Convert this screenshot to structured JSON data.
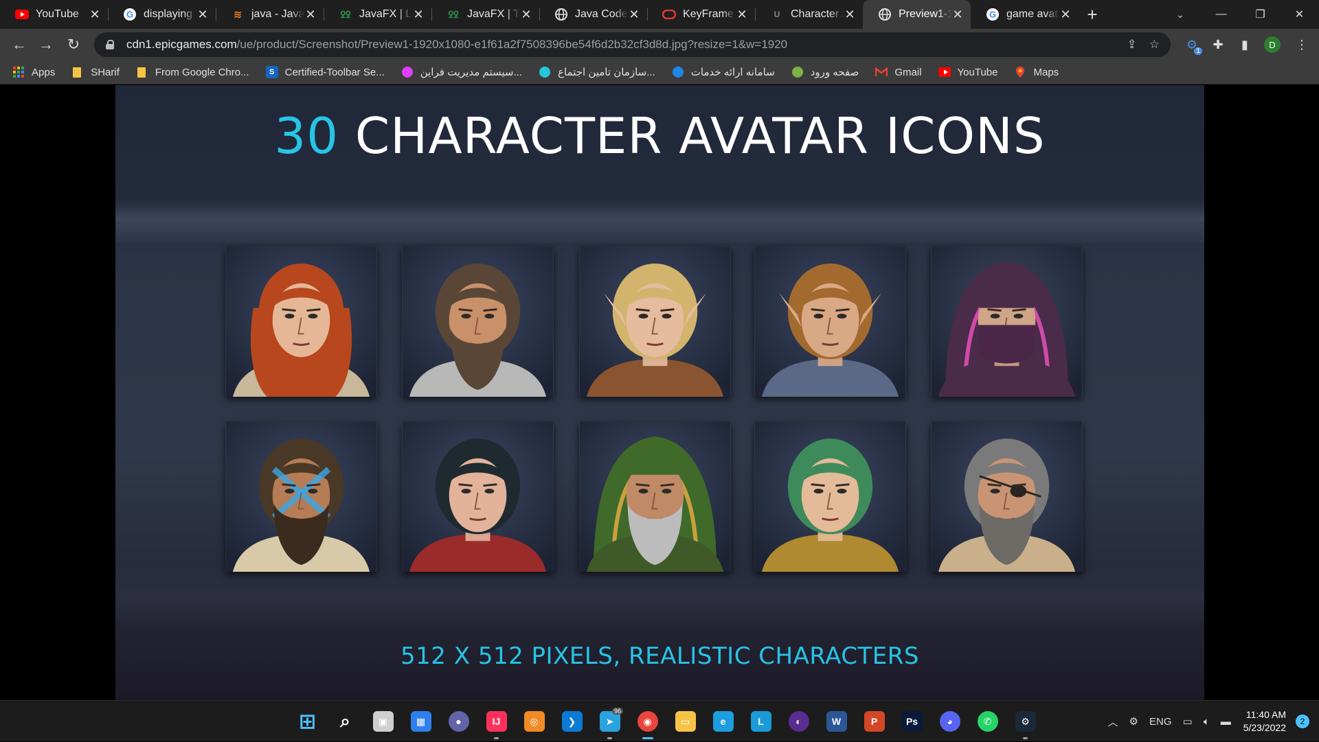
{
  "browser": {
    "tabs": [
      {
        "title": "YouTube",
        "favicon": "youtube-icon",
        "color": "#ff0000",
        "active": false
      },
      {
        "title": "displaying t",
        "favicon": "google-icon",
        "color": "#4285f4",
        "active": false
      },
      {
        "title": "java - JavaF",
        "favicon": "stackoverflow-icon",
        "color": "#f48024",
        "active": false
      },
      {
        "title": "JavaFX | Lab",
        "favicon": "geeksforgeeks-icon",
        "color": "#2f8d46",
        "active": false
      },
      {
        "title": "JavaFX | Tex",
        "favicon": "geeksforgeeks-icon",
        "color": "#2f8d46",
        "active": false
      },
      {
        "title": "Java Code E",
        "favicon": "globe-icon",
        "color": "#e0e0e0",
        "active": false
      },
      {
        "title": "KeyFrame (",
        "favicon": "oracle-icon",
        "color": "#e53935",
        "active": false
      },
      {
        "title": "Character A",
        "favicon": "unreal-icon",
        "color": "#444444",
        "active": false
      },
      {
        "title": "Preview1-1",
        "favicon": "globe-icon",
        "color": "#e0e0e0",
        "active": true
      },
      {
        "title": "game avata",
        "favicon": "google-icon",
        "color": "#4285f4",
        "active": false
      }
    ],
    "new_tab": "+",
    "url_host": "cdn1.epicgames.com",
    "url_path": "/ue/product/Screenshot/Preview1-1920x1080-e1f61a2f7508396be54f6d2b32cf3d8d.jpg?resize=1&w=1920",
    "profile_initial": "D",
    "extension_badge": "1",
    "bookmarks": [
      {
        "label": "Apps",
        "icon": "apps-grid-icon",
        "color": "#4285f4"
      },
      {
        "label": "SHarif",
        "icon": "folder-icon",
        "color": "#f6c445"
      },
      {
        "label": "From Google Chro...",
        "icon": "folder-icon",
        "color": "#f6c445"
      },
      {
        "label": "Certified-Toolbar Se...",
        "icon": "certified-icon",
        "color": "#1565c0"
      },
      {
        "label": "سیستم مدیریت فراین...",
        "icon": "flower-icon",
        "color": "#e040fb"
      },
      {
        "label": "سازمان تامین اجتماع...",
        "icon": "cloud-icon",
        "color": "#26c6da"
      },
      {
        "label": "سامانه ارائه خدمات",
        "icon": "emblem-icon",
        "color": "#1e88e5"
      },
      {
        "label": "صفحه ورود",
        "icon": "seal-icon",
        "color": "#7cb342"
      },
      {
        "label": "Gmail",
        "icon": "gmail-icon",
        "color": "#ea4335"
      },
      {
        "label": "YouTube",
        "icon": "youtube-icon",
        "color": "#ff0000"
      },
      {
        "label": "Maps",
        "icon": "maps-pin-icon",
        "color": "#34a853"
      }
    ]
  },
  "page": {
    "headline_number": "30",
    "headline_text": "CHARACTER AVATAR ICONS",
    "subline": "512 X 512 PIXELS, REALISTIC CHARACTERS",
    "accent_color": "#27c4e6",
    "avatars": [
      {
        "name": "red-haired-warrior-woman",
        "bg": "#2a3246",
        "skin": "#e5b797",
        "hair": "#b8471e",
        "garb": "#c9b79a",
        "beard": false,
        "hood": false,
        "mask": false,
        "elf": false
      },
      {
        "name": "bearded-dwarf",
        "bg": "#2a3246",
        "skin": "#c99169",
        "hair": "#5a4637",
        "garb": "#b8b8b8",
        "beard": true,
        "beardColor": "#5a4637",
        "hood": false,
        "mask": false,
        "elf": false
      },
      {
        "name": "blonde-elf-woman",
        "bg": "#2a3246",
        "skin": "#e6bc9e",
        "hair": "#d2b46c",
        "garb": "#8a5430",
        "beard": false,
        "hood": false,
        "mask": false,
        "elf": true
      },
      {
        "name": "elf-knight",
        "bg": "#2a3246",
        "skin": "#d9a885",
        "hair": "#a36a2f",
        "garb": "#5a6a86",
        "beard": false,
        "hood": false,
        "mask": false,
        "elf": true
      },
      {
        "name": "hooded-masked-assassin",
        "bg": "#2a3246",
        "skin": "#cfa487",
        "hair": "#222222",
        "garb": "#4a2b4a",
        "beard": false,
        "hood": true,
        "hoodColor": "#4a2b4a",
        "hoodTrim": "#d04aa8",
        "mask": true,
        "maskColor": "#4a2648",
        "elf": false
      },
      {
        "name": "blue-painted-barbarian",
        "bg": "#2a3246",
        "skin": "#b57c56",
        "hair": "#4a3826",
        "garb": "#d8c9a8",
        "beard": true,
        "beardColor": "#3a2b1e",
        "hood": false,
        "mask": false,
        "elf": false,
        "paint": "#3aa7e6"
      },
      {
        "name": "dark-haired-rogue-woman",
        "bg": "#2a3246",
        "skin": "#e2b39a",
        "hair": "#1e2a30",
        "garb": "#9b2a2a",
        "beard": false,
        "hood": false,
        "mask": false,
        "elf": false
      },
      {
        "name": "green-hooded-ranger",
        "bg": "#2a3246",
        "skin": "#c08a66",
        "hair": "#888888",
        "garb": "#3f5a28",
        "beard": true,
        "beardColor": "#bcbcbc",
        "hood": true,
        "hoodColor": "#3f6a2a",
        "hoodTrim": "#c9a13e",
        "mask": false,
        "elf": false
      },
      {
        "name": "green-haired-monk",
        "bg": "#2a3246",
        "skin": "#e3bb98",
        "hair": "#3f8a5a",
        "garb": "#b08a30",
        "beard": false,
        "hood": false,
        "mask": false,
        "elf": false
      },
      {
        "name": "eyepatch-old-warrior",
        "bg": "#2a3246",
        "skin": "#c89474",
        "hair": "#7a7a7a",
        "garb": "#c9b08a",
        "beard": true,
        "beardColor": "#6e6a66",
        "hood": false,
        "mask": false,
        "elf": false,
        "eyepatch": true
      }
    ]
  },
  "taskbar": {
    "apps": [
      {
        "name": "windows-start-icon",
        "color": "#4cc2ff",
        "glyph": "⊞"
      },
      {
        "name": "search-icon",
        "color": "#1c1c1c",
        "glyph": "⌕"
      },
      {
        "name": "task-view-icon",
        "color": "#cfcfcf",
        "glyph": "▣"
      },
      {
        "name": "widgets-icon",
        "color": "#2f80ed",
        "glyph": "▦"
      },
      {
        "name": "teams-chat-icon",
        "color": "#6264a7",
        "glyph": "●"
      },
      {
        "name": "intellij-icon",
        "color": "#fe315d",
        "glyph": "IJ"
      },
      {
        "name": "blender-like-icon",
        "color": "#f08a24",
        "glyph": "◎"
      },
      {
        "name": "vscode-icon",
        "color": "#0a7ad4",
        "glyph": "❯"
      },
      {
        "name": "telegram-icon",
        "color": "#2aa3de",
        "glyph": "➤"
      },
      {
        "name": "chrome-icon",
        "color": "#e8453c",
        "glyph": "◉"
      },
      {
        "name": "file-explorer-icon",
        "color": "#f6c445",
        "glyph": "▭"
      },
      {
        "name": "edge-icon",
        "color": "#1e9de0",
        "glyph": "e"
      },
      {
        "name": "lingoes-icon",
        "color": "#1a9ad6",
        "glyph": "L"
      },
      {
        "name": "media-player-icon",
        "color": "#5b2d91",
        "glyph": "◐"
      },
      {
        "name": "word-icon",
        "color": "#2b5797",
        "glyph": "W"
      },
      {
        "name": "wps-presentation-icon",
        "color": "#d24726",
        "glyph": "P"
      },
      {
        "name": "photoshop-icon",
        "color": "#0a1a3a",
        "glyph": "Ps"
      },
      {
        "name": "discord-icon",
        "color": "#5865f2",
        "glyph": "◕"
      },
      {
        "name": "whatsapp-icon",
        "color": "#25d366",
        "glyph": "✆"
      },
      {
        "name": "steam-icon",
        "color": "#1b2838",
        "glyph": "⚙"
      }
    ],
    "telegram_badge": "96",
    "language": "ENG",
    "time": "11:40 AM",
    "date": "5/23/2022",
    "notifications": "2"
  }
}
